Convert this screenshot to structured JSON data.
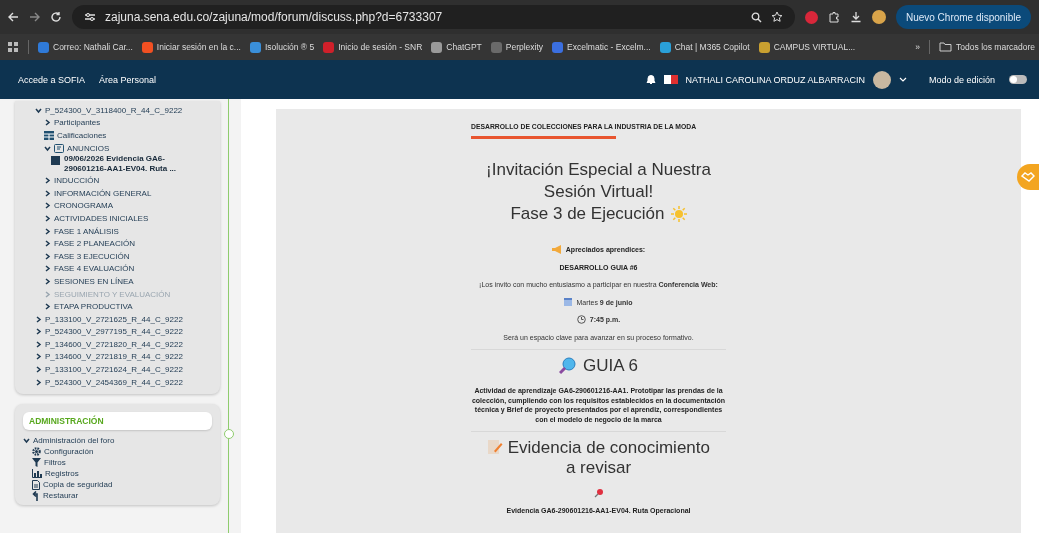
{
  "browser": {
    "url": "zajuna.sena.edu.co/zajuna/mod/forum/discuss.php?d=6733307",
    "update_button": "Nuevo Chrome disponible"
  },
  "bookmarks": [
    {
      "label": "Correo: Nathali Car...",
      "color": "#2f7ad8"
    },
    {
      "label": "Iniciar sesión en la c...",
      "color": "#f25022"
    },
    {
      "label": "Isolución ® 5",
      "color": "#3a8fd9"
    },
    {
      "label": "Inicio de sesión - SNR",
      "color": "#d0202a"
    },
    {
      "label": "ChatGPT",
      "color": "#9a9a9a"
    },
    {
      "label": "Perplexity",
      "color": "#6a6a6a"
    },
    {
      "label": "Excelmatic - Excelm...",
      "color": "#3b6fe0"
    },
    {
      "label": "Chat | M365 Copilot",
      "color": "#2aa0d8"
    },
    {
      "label": "CAMPUS VIRTUAL...",
      "color": "#c9a030"
    }
  ],
  "bookmarks_more": "»",
  "all_bookmarks": "Todos los marcadore",
  "navbar": {
    "links": [
      "Accede a SOFIA",
      "Área Personal"
    ],
    "user": "NATHALI CAROLINA ORDUZ ALBARRACIN",
    "edit_mode": {
      "label": "Modo de edición",
      "on": false
    }
  },
  "course_tree": [
    {
      "label": "P_524300_V_3118400_R_44_C_9222",
      "kind": "node",
      "expanded": true,
      "children": [
        {
          "label": "Participantes",
          "kind": "node",
          "expanded": false,
          "disabled": false
        },
        {
          "label": "Calificaciones",
          "kind": "grades",
          "disabled": false
        },
        {
          "label": "ANUNCIOS",
          "kind": "forum",
          "expanded": true,
          "disabled": false,
          "children": [
            {
              "label": "09/06/2026 Evidencia GA6-290601216-AA1-EV04. Ruta ...",
              "kind": "post"
            }
          ]
        },
        {
          "label": "INDUCCIÓN",
          "kind": "node",
          "expanded": false,
          "disabled": false
        },
        {
          "label": "INFORMACIÓN GENERAL",
          "kind": "node",
          "expanded": false,
          "disabled": false
        },
        {
          "label": "CRONOGRAMA",
          "kind": "node",
          "expanded": false,
          "disabled": false
        },
        {
          "label": "ACTIVIDADES INICIALES",
          "kind": "node",
          "expanded": false,
          "disabled": false
        },
        {
          "label": "FASE 1 ANÁLISIS",
          "kind": "node",
          "expanded": false,
          "disabled": false
        },
        {
          "label": "FASE 2 PLANEACIÓN",
          "kind": "node",
          "expanded": false,
          "disabled": false
        },
        {
          "label": "FASE 3 EJECUCIÓN",
          "kind": "node",
          "expanded": false,
          "disabled": false
        },
        {
          "label": "FASE 4 EVALUACIÓN",
          "kind": "node",
          "expanded": false,
          "disabled": false
        },
        {
          "label": "SESIONES EN LÍNEA",
          "kind": "node",
          "expanded": false,
          "disabled": false
        },
        {
          "label": "SEGUIMIENTO Y EVALUACIÓN",
          "kind": "node",
          "expanded": false,
          "disabled": true
        },
        {
          "label": "ETAPA PRODUCTIVA",
          "kind": "node",
          "expanded": false,
          "disabled": false
        }
      ]
    },
    {
      "label": "P_133100_V_2721625_R_44_C_9222",
      "kind": "node",
      "expanded": false
    },
    {
      "label": "P_524300_V_2977195_R_44_C_9222",
      "kind": "node",
      "expanded": false
    },
    {
      "label": "P_134600_V_2721820_R_44_C_9222",
      "kind": "node",
      "expanded": false
    },
    {
      "label": "P_134600_V_2721819_R_44_C_9222",
      "kind": "node",
      "expanded": false
    },
    {
      "label": "P_133100_V_2721624_R_44_C_9222",
      "kind": "node",
      "expanded": false
    },
    {
      "label": "P_524300_V_2454369_R_44_C_9222",
      "kind": "node",
      "expanded": false
    }
  ],
  "administration": {
    "title": "ADMINISTRACIÓN",
    "group": {
      "label": "Administración del foro",
      "expanded": true,
      "items": [
        {
          "label": "Configuración",
          "kind": "gear"
        },
        {
          "label": "Filtros",
          "kind": "filter"
        },
        {
          "label": "Registros",
          "kind": "chart"
        },
        {
          "label": "Copia de seguridad",
          "kind": "backup"
        },
        {
          "label": "Restaurar",
          "kind": "restore"
        }
      ]
    }
  },
  "post": {
    "course_title": "DESARROLLO DE COLECCIONES PARA LA INDUSTRIA DE LA MODA",
    "heading": [
      "¡Invitación Especial a Nuestra Sesión Virtual!",
      "Fase 3 de Ejecución"
    ],
    "blocks": [
      {
        "kind": "greeting",
        "text": "Apreciados aprendices:"
      },
      {
        "kind": "bold",
        "text": "DESARROLLO GUIA #6"
      },
      {
        "kind": "text",
        "text": "¡Los invito con mucho entusiasmo a participar en nuestra **Conferencia Web:**"
      },
      {
        "kind": "date",
        "text": "Martes **9 de junio**"
      },
      {
        "kind": "time",
        "text": "**7:45 p.m.**"
      },
      {
        "kind": "text",
        "text": "Será un espacio clave para avanzar en su proceso formativo."
      },
      {
        "kind": "rule"
      },
      {
        "kind": "guide_title",
        "text": "GUIA 6"
      },
      {
        "kind": "bold",
        "text": "Actividad de aprendizaje GA6-290601216-AA1. Prototipar las prendas de la colección, cumpliendo con los requisitos establecidos en la documentación técnica y Brief de proyecto presentados por el aprendiz, correspondientes con el modelo de negocio de la marca"
      },
      {
        "kind": "rule"
      },
      {
        "kind": "evidence_title",
        "text": "Evidencia de conocimiento a revisar"
      },
      {
        "kind": "pin"
      },
      {
        "kind": "link",
        "text": "Evidencia GA6-290601216-AA1-EV04. Ruta Operacional"
      }
    ]
  }
}
